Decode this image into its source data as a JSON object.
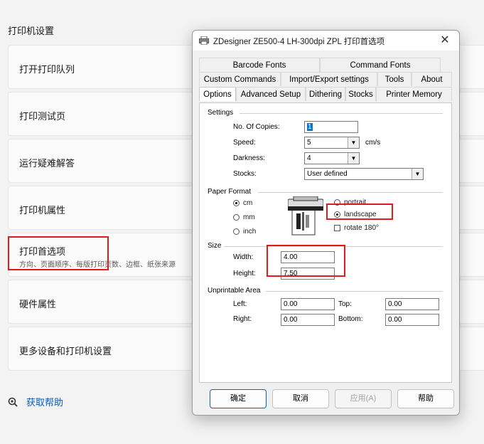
{
  "page": {
    "section_title": "打印机设置",
    "items": [
      {
        "label": "打开打印队列"
      },
      {
        "label": "打印测试页"
      },
      {
        "label": "运行疑难解答"
      },
      {
        "label": "打印机属性"
      },
      {
        "label": "打印首选项",
        "sub": "方向、页面顺序、每版打印页数、边框、纸张来源"
      },
      {
        "label": "硬件属性"
      },
      {
        "label": "更多设备和打印机设置"
      }
    ],
    "help_link": "获取帮助"
  },
  "dialog": {
    "title": "ZDesigner ZE500-4 LH-300dpi ZPL 打印首选项",
    "close_glyph": "✕",
    "tabs_row1": [
      "Barcode Fonts",
      "Command Fonts"
    ],
    "tabs_row2": [
      "Custom Commands",
      "Import/Export settings",
      "Tools",
      "About"
    ],
    "tabs_row3": [
      "Options",
      "Advanced Setup",
      "Dithering",
      "Stocks",
      "Printer Memory"
    ],
    "active_tab": "Options",
    "settings": {
      "group": "Settings",
      "copies_label": "No. Of Copies:",
      "copies_value": "1",
      "speed_label": "Speed:",
      "speed_value": "5",
      "speed_unit": "cm/s",
      "darkness_label": "Darkness:",
      "darkness_value": "4",
      "stocks_label": "Stocks:",
      "stocks_value": "User defined"
    },
    "paper_format": {
      "group": "Paper Format",
      "units": [
        "cm",
        "mm",
        "inch"
      ],
      "selected_unit": "cm",
      "orientations": [
        "portrait",
        "landscape"
      ],
      "selected_orientation": "landscape",
      "rotate_label": "rotate 180°"
    },
    "size": {
      "group": "Size",
      "width_label": "Width:",
      "width_value": "4.00",
      "height_label": "Height:",
      "height_value": "7.50"
    },
    "unprintable": {
      "group": "Unprintable Area",
      "left_label": "Left:",
      "left_value": "0.00",
      "top_label": "Top:",
      "top_value": "0.00",
      "right_label": "Right:",
      "right_value": "0.00",
      "bottom_label": "Bottom:",
      "bottom_value": "0.00"
    },
    "buttons": {
      "ok": "确定",
      "cancel": "取消",
      "apply": "应用(A)",
      "help": "帮助"
    }
  },
  "colors": {
    "highlight": "#e01b1b",
    "link": "#0a5db8",
    "accent": "#0078d7"
  }
}
